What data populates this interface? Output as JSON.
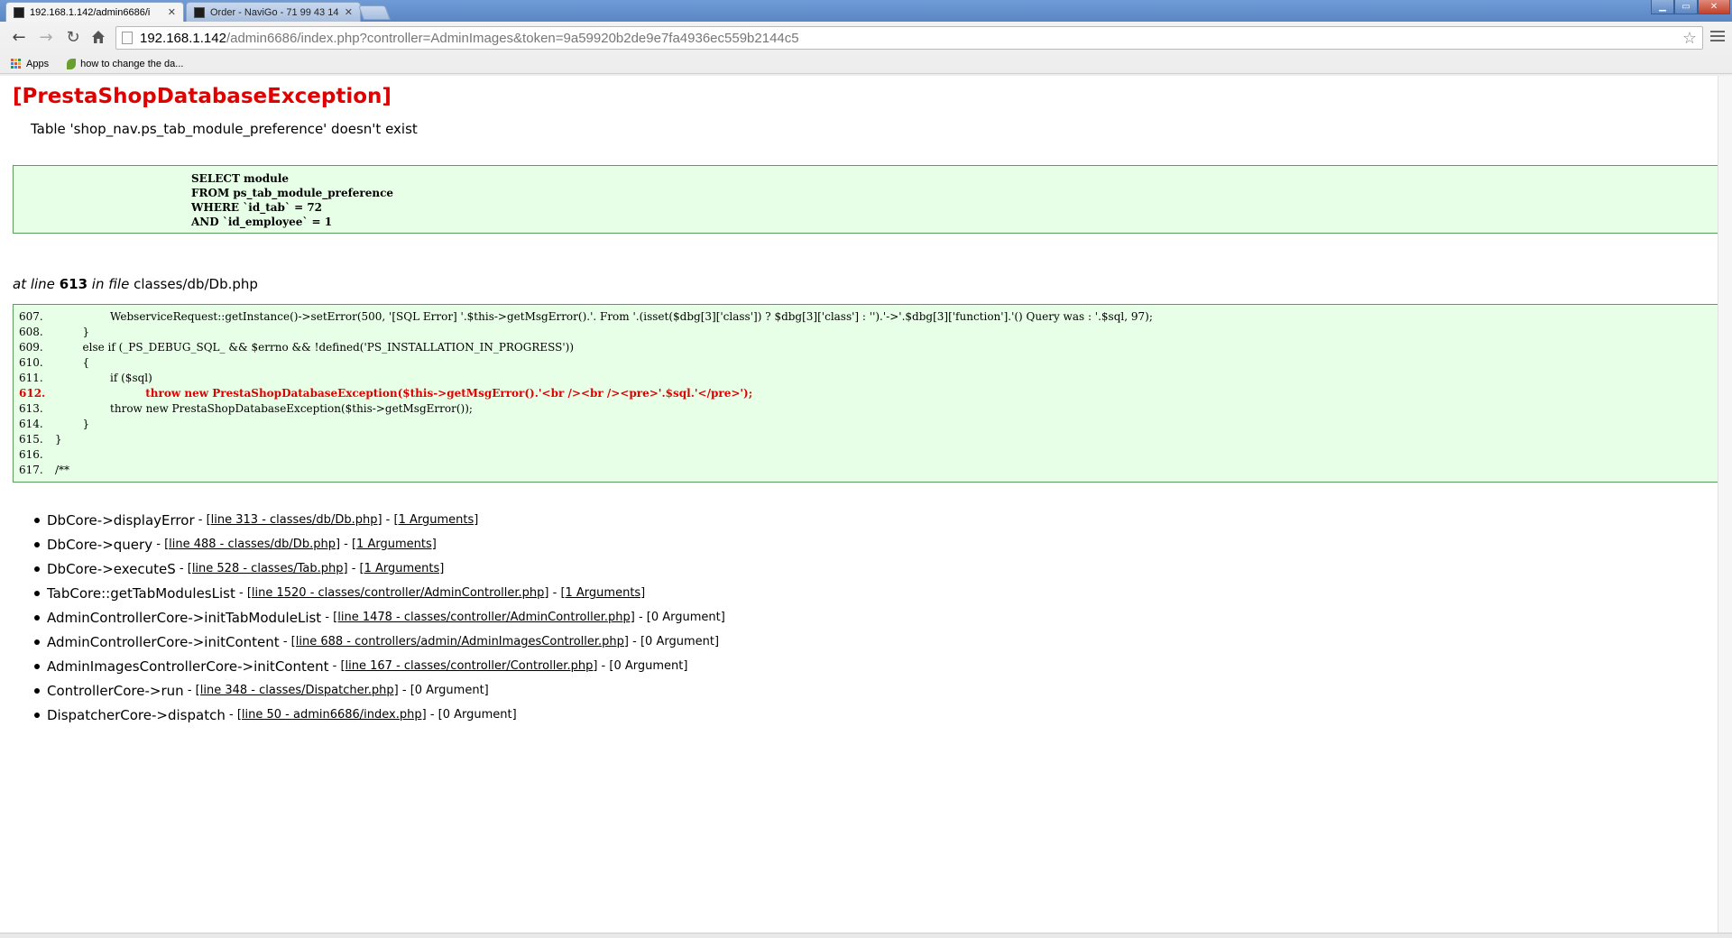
{
  "browser": {
    "tabs": [
      {
        "title": "192.168.1.142/admin6686/i",
        "active": true
      },
      {
        "title": "Order - NaviGo - 71 99 43 14",
        "active": false
      }
    ],
    "url_host": "192.168.1.142",
    "url_path": "/admin6686/index.php?controller=AdminImages&token=9a59920b2de9e7fa4936ec559b2144c5",
    "bookmarks": [
      {
        "label": "Apps"
      },
      {
        "label": "how to change the da..."
      }
    ],
    "window_controls": {
      "minimize": "▁",
      "maximize": "▭",
      "close": "✕"
    }
  },
  "error": {
    "title": "[PrestaShopDatabaseException]",
    "message": "Table 'shop_nav.ps_tab_module_preference' doesn't exist",
    "sql": [
      "SELECT module",
      "FROM ps_tab_module_preference",
      "WHERE `id_tab` = 72",
      "AND `id_employee` = 1"
    ],
    "location": {
      "prefix": "at line",
      "line": "613",
      "infile": "in file",
      "file": "classes/db/Db.php"
    },
    "source": [
      {
        "num": "607.",
        "code": "                WebserviceRequest::getInstance()->setError(500, '[SQL Error] '.$this->getMsgError().'. From '.(isset($dbg[3]['class']) ? $dbg[3]['class'] : '').'->'.$dbg[3]['function'].'() Query was : '.$sql, 97);"
      },
      {
        "num": "608.",
        "code": "        }"
      },
      {
        "num": "609.",
        "code": "        else if (_PS_DEBUG_SQL_ && $errno && !defined('PS_INSTALLATION_IN_PROGRESS'))"
      },
      {
        "num": "610.",
        "code": "        {"
      },
      {
        "num": "611.",
        "code": "                if ($sql)"
      },
      {
        "num": "612.",
        "code": "                        throw new PrestaShopDatabaseException($this->getMsgError().'<br /><br /><pre>'.$sql.'</pre>');",
        "error": true
      },
      {
        "num": "613.",
        "code": "                throw new PrestaShopDatabaseException($this->getMsgError());"
      },
      {
        "num": "614.",
        "code": "        }"
      },
      {
        "num": "615.",
        "code": "}"
      },
      {
        "num": "616.",
        "code": ""
      },
      {
        "num": "617.",
        "code": "/**"
      }
    ],
    "trace": [
      {
        "cls": "DbCore",
        "sep": "->",
        "fn": "displayError",
        "loc": "[line 313 - classes/db/Db.php]",
        "args": "[1 Arguments]",
        "args_link": true
      },
      {
        "cls": "DbCore",
        "sep": "->",
        "fn": "query",
        "loc": "[line 488 - classes/db/Db.php]",
        "args": "[1 Arguments]",
        "args_link": true
      },
      {
        "cls": "DbCore",
        "sep": "->",
        "fn": "executeS",
        "loc": "[line 528 - classes/Tab.php]",
        "args": "[1 Arguments]",
        "args_link": true
      },
      {
        "cls": "TabCore",
        "sep": "::",
        "fn": "getTabModulesList",
        "loc": "[line 1520 - classes/controller/AdminController.php]",
        "args": "[1 Arguments]",
        "args_link": true
      },
      {
        "cls": "AdminControllerCore",
        "sep": "->",
        "fn": "initTabModuleList",
        "loc": "[line 1478 - classes/controller/AdminController.php]",
        "args": "[0 Argument]",
        "args_link": false
      },
      {
        "cls": "AdminControllerCore",
        "sep": "->",
        "fn": "initContent",
        "loc": "[line 688 - controllers/admin/AdminImagesController.php]",
        "args": "[0 Argument]",
        "args_link": false
      },
      {
        "cls": "AdminImagesControllerCore",
        "sep": "->",
        "fn": "initContent",
        "loc": "[line 167 - classes/controller/Controller.php]",
        "args": "[0 Argument]",
        "args_link": false
      },
      {
        "cls": "ControllerCore",
        "sep": "->",
        "fn": "run",
        "loc": "[line 348 - classes/Dispatcher.php]",
        "args": "[0 Argument]",
        "args_link": false
      },
      {
        "cls": "DispatcherCore",
        "sep": "->",
        "fn": "dispatch",
        "loc": "[line 50 - admin6686/index.php]",
        "args": "[0 Argument]",
        "args_link": false
      }
    ]
  }
}
